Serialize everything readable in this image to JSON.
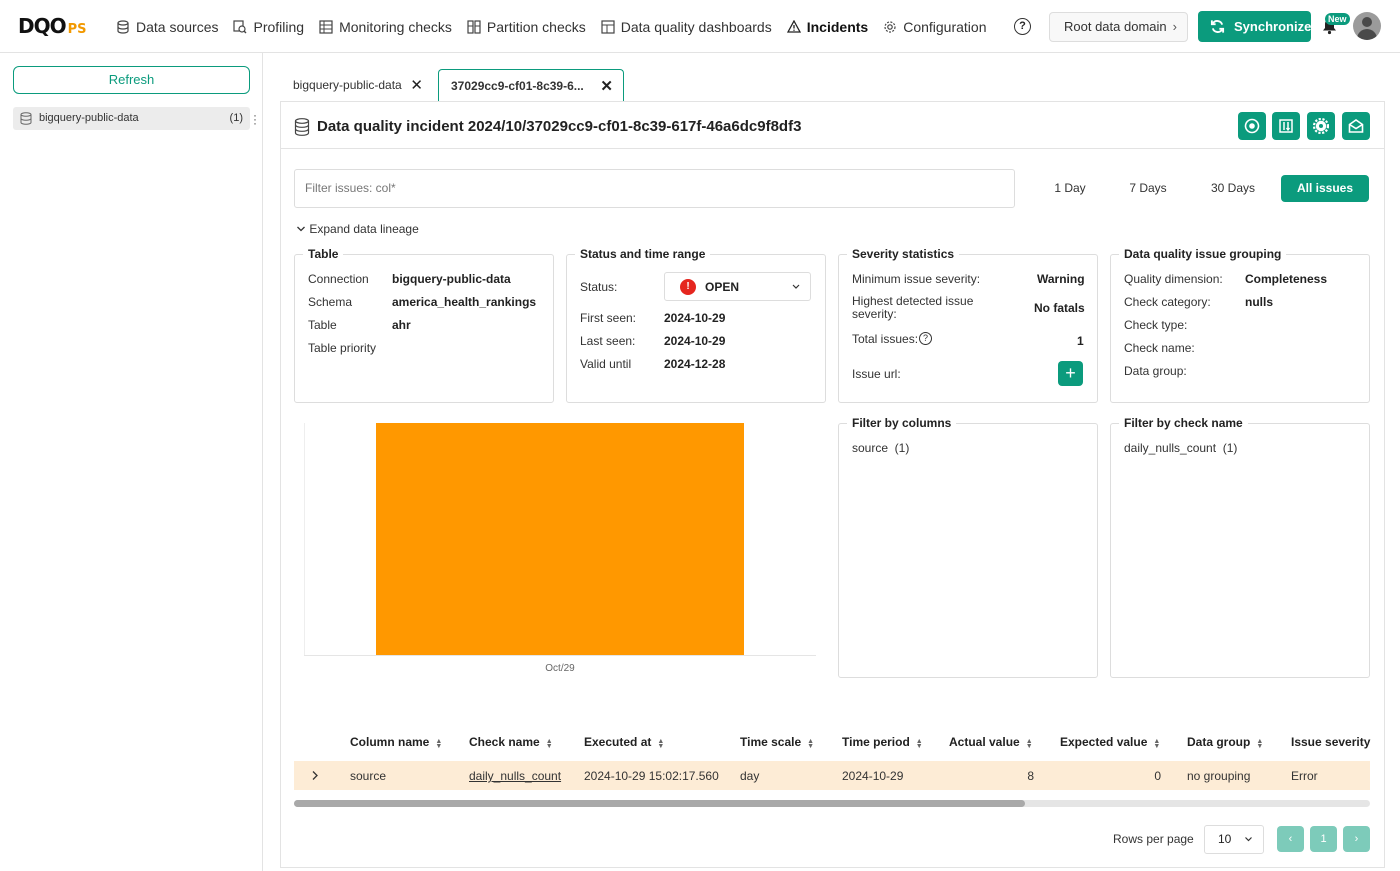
{
  "brand": {
    "main": "DQO",
    "suffix": "PS"
  },
  "nav": [
    {
      "label": "Data sources",
      "icon": "data-sources-icon"
    },
    {
      "label": "Profiling",
      "icon": "profiling-icon"
    },
    {
      "label": "Monitoring checks",
      "icon": "monitoring-icon"
    },
    {
      "label": "Partition checks",
      "icon": "partition-icon"
    },
    {
      "label": "Data quality dashboards",
      "icon": "dashboard-icon"
    },
    {
      "label": "Incidents",
      "icon": "warning-icon"
    },
    {
      "label": "Configuration",
      "icon": "gear-icon"
    }
  ],
  "header": {
    "help": "?",
    "domain": "Root data domain",
    "sync": "Synchronize",
    "new_badge": "New"
  },
  "sidebar": {
    "refresh": "Refresh",
    "item": {
      "label": "bigquery-public-data",
      "count": "(1)"
    }
  },
  "tabs": [
    {
      "label": "bigquery-public-data"
    },
    {
      "label": "37029cc9-cf01-8c39-6..."
    }
  ],
  "page": {
    "title": "Data quality incident 2024/10/37029cc9-cf01-8c39-617f-46a6dc9f8df3",
    "filter_placeholder": "Filter issues: col*",
    "ranges": [
      "1 Day",
      "7 Days",
      "30 Days",
      "All issues"
    ],
    "active_range": "All issues",
    "expand_lineage": "Expand data lineage"
  },
  "table_box": {
    "title": "Table",
    "rows": [
      {
        "k": "Connection",
        "v": "bigquery-public-data"
      },
      {
        "k": "Schema",
        "v": "america_health_rankings"
      },
      {
        "k": "Table",
        "v": "ahr"
      },
      {
        "k": "Table priority",
        "v": ""
      }
    ]
  },
  "status_box": {
    "title": "Status and time range",
    "status_label": "Status:",
    "status_value": "OPEN",
    "rows": [
      {
        "k": "First seen:",
        "v": "2024-10-29"
      },
      {
        "k": "Last seen:",
        "v": "2024-10-29"
      },
      {
        "k": "Valid until",
        "v": "2024-12-28"
      }
    ]
  },
  "severity_box": {
    "title": "Severity statistics",
    "min_label": "Minimum issue severity:",
    "min_value": "Warning",
    "highest_label": "Highest detected issue severity:",
    "highest_value": "No fatals",
    "total_label": "Total issues:",
    "total_value": "1",
    "url_label": "Issue url:",
    "url_button": "+"
  },
  "grouping_box": {
    "title": "Data quality issue grouping",
    "rows": [
      {
        "k": "Quality dimension:",
        "v": "Completeness"
      },
      {
        "k": "Check category:",
        "v": "nulls"
      },
      {
        "k": "Check type:",
        "v": ""
      },
      {
        "k": "Check name:",
        "v": ""
      },
      {
        "k": "Data group:",
        "v": ""
      }
    ]
  },
  "filter_columns": {
    "title": "Filter by columns",
    "items": [
      "source  (1)"
    ]
  },
  "filter_checks": {
    "title": "Filter by check name",
    "items": [
      "daily_nulls_count  (1)"
    ]
  },
  "chart_data": {
    "type": "bar",
    "categories": [
      "Oct/29"
    ],
    "values": [
      1
    ],
    "ylim": [
      0,
      1
    ],
    "colors": [
      "#ff9800"
    ]
  },
  "issues": {
    "columns": [
      "Column name",
      "Check name",
      "Executed at",
      "Time scale",
      "Time period",
      "Actual value",
      "Expected value",
      "Data group",
      "Issue severity"
    ],
    "rows": [
      {
        "column": "source",
        "check": "daily_nulls_count",
        "executed": "2024-10-29 15:02:17.560",
        "scale": "day",
        "period": "2024-10-29",
        "actual": "8",
        "expected": "0",
        "group": "no grouping",
        "severity": "Error"
      }
    ]
  },
  "pagination": {
    "rows_label": "Rows per page",
    "rows_value": "10",
    "prev": "‹",
    "page": "1",
    "next": "›"
  },
  "colors": {
    "accent": "#0b9b7d",
    "bar": "#ff9800",
    "row_highlight": "#fdecd6",
    "open_status": "#e5261f"
  }
}
